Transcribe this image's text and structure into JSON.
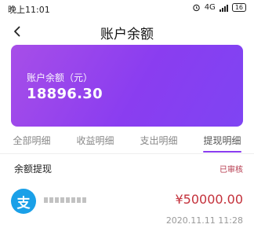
{
  "status_bar": {
    "time": "晚上11:01",
    "network": "4G",
    "battery": "16"
  },
  "nav": {
    "back_icon": "chevron-left-icon",
    "title": "账户余额"
  },
  "balance_card": {
    "label": "账户余额（元）",
    "value": "18896.30",
    "gradient_start": "#a74ee8",
    "gradient_end": "#7f44f3"
  },
  "tabs": [
    {
      "label": "全部明细",
      "active": false
    },
    {
      "label": "收益明细",
      "active": false
    },
    {
      "label": "支出明细",
      "active": false
    },
    {
      "label": "提现明细",
      "active": true
    }
  ],
  "section": {
    "title": "余额提现",
    "status": "已审核"
  },
  "record": {
    "icon": "alipay-icon",
    "icon_glyph": "支",
    "amount": "¥50000.00",
    "time": "2020.11.11 11:28",
    "amount_color": "#c4313b"
  }
}
